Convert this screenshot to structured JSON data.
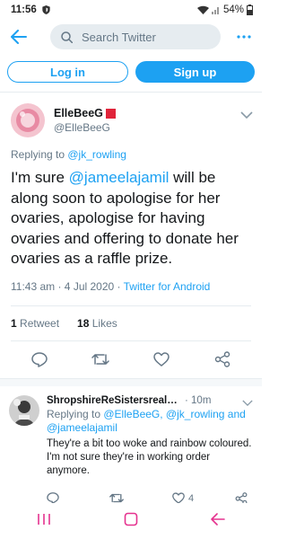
{
  "status_bar": {
    "time": "11:56",
    "battery": "54%"
  },
  "search": {
    "placeholder": "Search Twitter"
  },
  "auth": {
    "login_label": "Log in",
    "signup_label": "Sign up"
  },
  "tweet": {
    "display_name": "ElleBeeG",
    "handle": "@ElleBeeG",
    "replying_prefix": "Replying to ",
    "replying_to": "@jk_rowling",
    "text_mention": "@jameelajamil",
    "text_before": "I'm sure ",
    "text_after": " will be along soon to apologise for her ovaries, apologise for having ovaries and offering to donate her ovaries as a raffle prize.",
    "timestamp": "11:43 am · 4 Jul 2020 · ",
    "client": "Twitter for Android",
    "retweets_count": "1",
    "retweets_label": " Retweet",
    "likes_count": "18",
    "likes_label": " Likes"
  },
  "reply": {
    "display_name": "ShropshireReSistersrealname...",
    "time": "· 10m",
    "replying_prefix": "Replying to ",
    "replying_to": "@ElleBeeG, @jk_rowling and @jameelajamil",
    "text": "They're a bit too woke and rainbow coloured. I'm not sure they're in working order anymore.",
    "likes_count": "4"
  },
  "colors": {
    "accent": "#1da1f2",
    "badge_red": "#e0243a",
    "muted": "#657786"
  },
  "icons": [
    "shield-icon",
    "wifi-icon",
    "signal-icon",
    "battery-icon",
    "back-arrow-icon",
    "search-icon",
    "more-icon",
    "chevron-down-icon",
    "reply-icon",
    "retweet-icon",
    "like-icon",
    "share-icon",
    "recents-icon",
    "home-icon",
    "nav-back-icon"
  ]
}
